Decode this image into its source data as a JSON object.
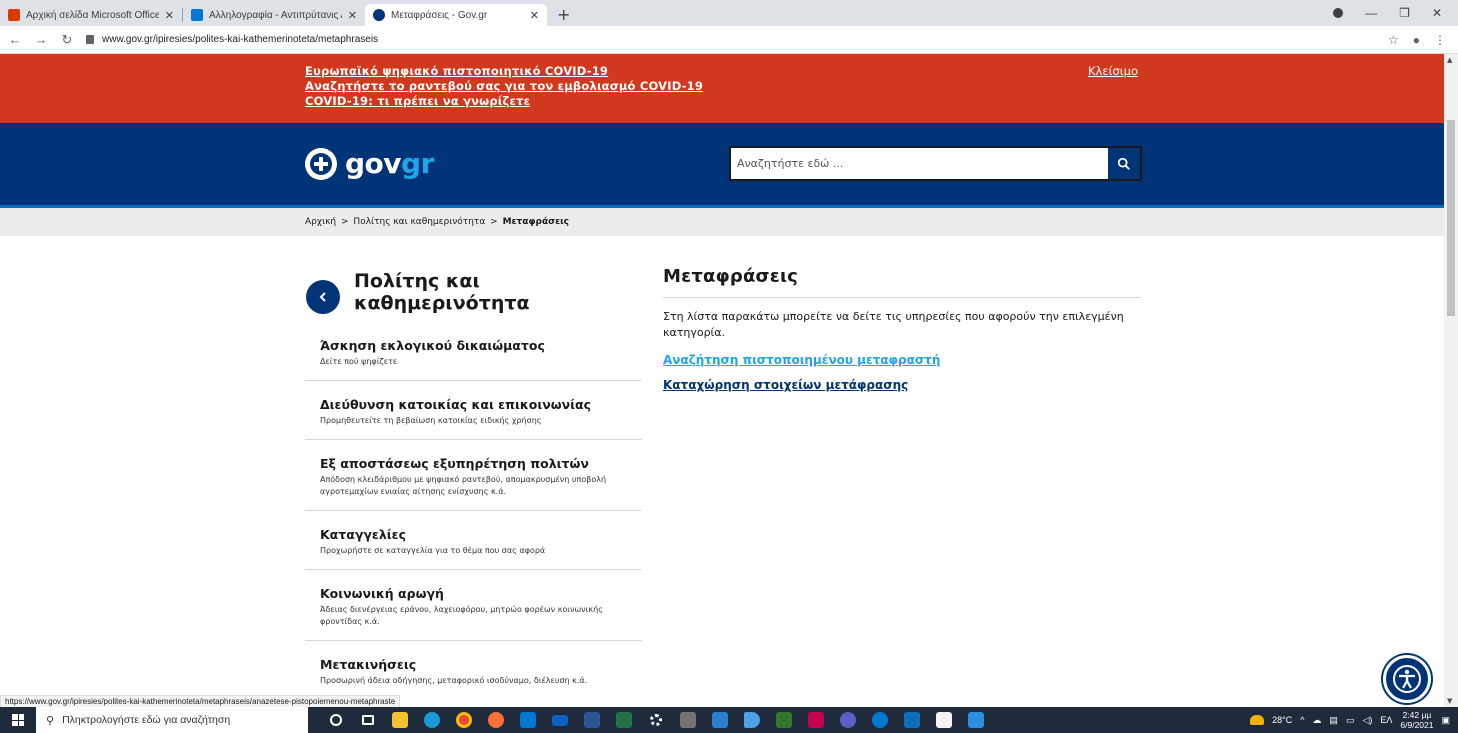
{
  "browser": {
    "tabs": [
      {
        "title": "Αρχική σελίδα Microsoft Office",
        "favicon_color": "#d83b01"
      },
      {
        "title": "Αλληλογραφία - Αντιπρύτανις Α",
        "favicon_color": "#0078d4"
      },
      {
        "title": "Μεταφράσεις - Gov.gr",
        "favicon_color": "#003476"
      }
    ],
    "url": "www.gov.gr/ipiresies/polites-kai-kathemerinoteta/metaphraseis",
    "status_url": "https://www.gov.gr/ipiresies/polites-kai-kathemerinoteta/metaphraseis/anazetese-pistopoiemenou-metaphraste"
  },
  "alert": {
    "links": [
      "Ευρωπαϊκό ψηφιακό πιστοποιητικό COVID-19",
      "Αναζητήστε το ραντεβού σας για τον εμβολιασμό COVID-19",
      "COVID-19: τι πρέπει να γνωρίζετε"
    ],
    "close_label": "Κλείσιμο",
    "color": "#d0391e"
  },
  "header": {
    "logo_gov": "gov",
    "logo_gr": "gr",
    "search_placeholder": "Αναζητήστε εδώ ...",
    "color": "#003476"
  },
  "breadcrumb": {
    "home": "Αρχική",
    "sep": ">",
    "section": "Πολίτης και καθημερινότητα",
    "current": "Μεταφράσεις"
  },
  "sidebar": {
    "title": "Πολίτης και καθημερινότητα",
    "items": [
      {
        "title": "Άσκηση εκλογικού δικαιώματος",
        "desc": "Δείτε πού ψηφίζετε"
      },
      {
        "title": "Διεύθυνση κατοικίας και επικοινωνίας",
        "desc": "Προμηθευτείτε τη βεβαίωση κατοικίας ειδικής χρήσης"
      },
      {
        "title": "Εξ αποστάσεως εξυπηρέτηση πολιτών",
        "desc": "Απόδοση κλειδάριθμου με ψηφιακό ραντεβού, απομακρυσμένη υποβολή αγροτεμαχίων ενιαίας αίτησης ενίσχυσης κ.ά."
      },
      {
        "title": "Καταγγελίες",
        "desc": "Προχωρήστε σε καταγγελία για το θέμα που σας αφορά"
      },
      {
        "title": "Κοινωνική αρωγή",
        "desc": "Άδειας διενέργειας εράνου, λαχειοφόρου, μητρώο φορέων κοινωνικής φροντίδας κ.ά."
      },
      {
        "title": "Μετακινήσεις",
        "desc": "Προσωρινή άδεια οδήγησης, μεταφορικό ισοδύναμο, διέλευση κ.ά."
      }
    ]
  },
  "main": {
    "title": "Μεταφράσεις",
    "intro": "Στη λίστα παρακάτω μπορείτε να δείτε τις υπηρεσίες που αφορούν την επιλεγμένη κατηγορία.",
    "links": [
      "Αναζήτηση πιστοποιημένου μεταφραστή",
      "Καταχώρηση στοιχείων μετάφρασης"
    ]
  },
  "taskbar": {
    "search_placeholder": "Πληκτρολογήστε εδώ για αναζήτηση",
    "weather": "28°C",
    "lang": "ΕΛ",
    "time": "2:42 μμ",
    "date": "6/9/2021"
  }
}
